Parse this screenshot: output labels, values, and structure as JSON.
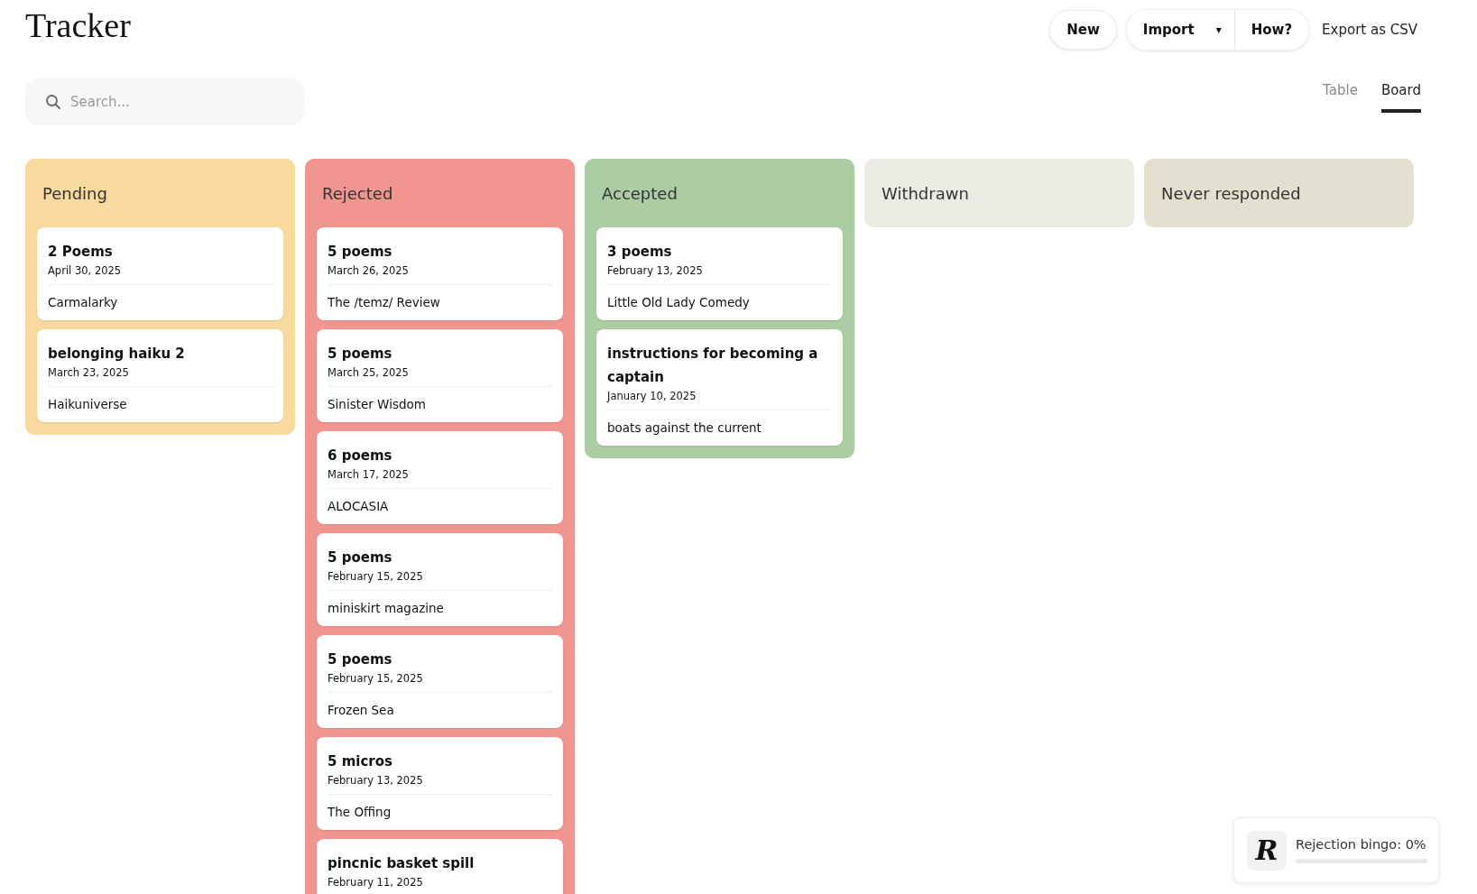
{
  "app_title": "Tracker",
  "actions": {
    "new": "New",
    "import": "Import",
    "import_menu": "▾",
    "how": "How?",
    "export": "Export as CSV"
  },
  "search": {
    "placeholder": "Search..."
  },
  "view_tabs": [
    {
      "label": "Table",
      "selected": false
    },
    {
      "label": "Board",
      "selected": true
    }
  ],
  "columns": [
    {
      "title": "Pending",
      "color": "#f8d99e",
      "cards": [
        {
          "title": "2 Poems",
          "date": "April 30, 2025",
          "venue": "Carmalarky"
        },
        {
          "title": "belonging haiku 2",
          "date": "March 23, 2025",
          "venue": "Haikuniverse"
        }
      ]
    },
    {
      "title": "Rejected",
      "color": "#f0968f",
      "cards": [
        {
          "title": "5 poems",
          "date": "March 26, 2025",
          "venue": "The /temz/ Review"
        },
        {
          "title": "5 poems",
          "date": "March 25, 2025",
          "venue": "Sinister Wisdom"
        },
        {
          "title": "6 poems",
          "date": "March 17, 2025",
          "venue": "ALOCASIA"
        },
        {
          "title": "5 poems",
          "date": "February 15, 2025",
          "venue": "miniskirt magazine"
        },
        {
          "title": "5 poems",
          "date": "February 15, 2025",
          "venue": "Frozen Sea"
        },
        {
          "title": "5 micros",
          "date": "February 13, 2025",
          "venue": "The Offing"
        },
        {
          "title": "pincnic basket spill",
          "date": "February 11, 2025"
        }
      ]
    },
    {
      "title": "Accepted",
      "color": "#abcda3",
      "cards": [
        {
          "title": "3 poems",
          "date": "February 13, 2025",
          "venue": "Little Old Lady Comedy"
        },
        {
          "title": "instructions for becoming a captain",
          "date": "January 10, 2025",
          "venue": "boats against the current"
        }
      ]
    },
    {
      "title": "Withdrawn",
      "color": "#ecebe3"
    },
    {
      "title": "Never responded",
      "color": "#e3e0d0"
    }
  ],
  "bingo": {
    "logo": "R",
    "label": "Rejection bingo: 0%",
    "level": 0
  }
}
